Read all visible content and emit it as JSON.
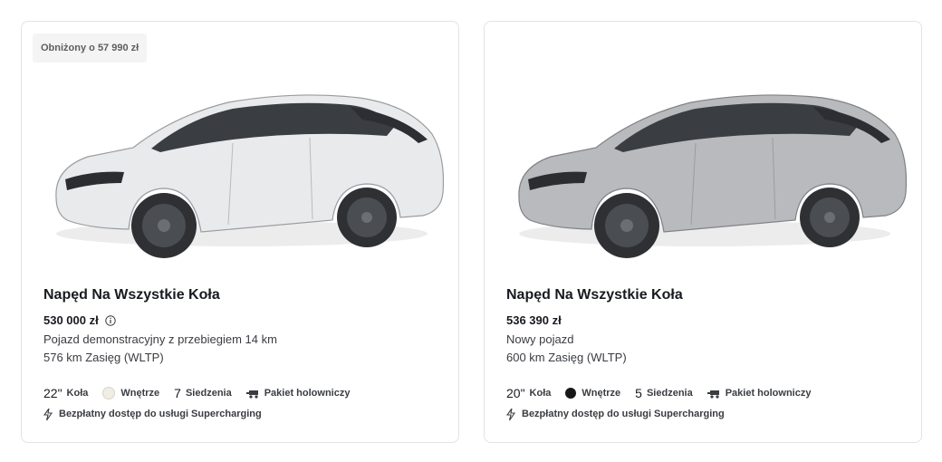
{
  "cards": [
    {
      "badge": "Obniżony o 57 990 zł",
      "title": "Napęd Na Wszystkie Koła",
      "price": "530 000 zł",
      "line1": "Pojazd demonstracyjny z przebiegiem 14 km",
      "line2": "576 km Zasięg (WLTP)",
      "wheels_value": "22\"",
      "wheels_label": "Koła",
      "interior_label": "Wnętrze",
      "interior_color": "#f1ede4",
      "seats_value": "7",
      "seats_label": "Siedzenia",
      "tow_label": "Pakiet holowniczy",
      "supercharging": "Bezpłatny dostęp do usługi Supercharging",
      "icons": [
        "car-image",
        "info-icon",
        "interior-swatch",
        "tow-hitch-icon",
        "lightning-bolt-icon"
      ],
      "car_color": "#e9eaec"
    },
    {
      "title": "Napęd Na Wszystkie Koła",
      "price": "536 390 zł",
      "line1": "Nowy pojazd",
      "line2": "600 km Zasięg (WLTP)",
      "wheels_value": "20\"",
      "wheels_label": "Koła",
      "interior_label": "Wnętrze",
      "interior_color": "#171717",
      "seats_value": "5",
      "seats_label": "Siedzenia",
      "tow_label": "Pakiet holowniczy",
      "supercharging": "Bezpłatny dostęp do usługi Supercharging",
      "icons": [
        "car-image",
        "interior-swatch",
        "tow-hitch-icon",
        "lightning-bolt-icon"
      ],
      "car_color": "#b8babd"
    }
  ]
}
